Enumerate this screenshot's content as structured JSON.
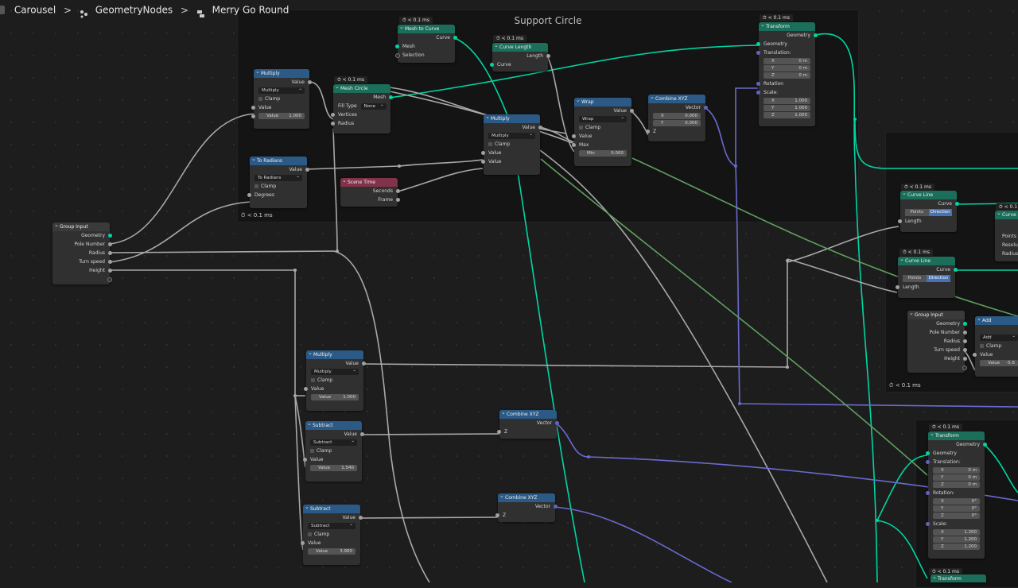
{
  "breadcrumb": {
    "items": [
      "Carousel",
      "GeometryNodes",
      "Merry Go Round"
    ],
    "separator": ">"
  },
  "frames": {
    "support_circle": {
      "label": "Support Circle",
      "timing": "< 0.1 ms"
    },
    "right_frame": {
      "timing": "< 0.1 ms"
    }
  },
  "timings": {
    "lt01": "< 0.1 ms"
  },
  "nodes": {
    "multiply1": {
      "title": "Multiply",
      "out": "Value",
      "op": "Multiply",
      "clamp": "Clamp",
      "in": "Value",
      "field_label": "Value",
      "field_value": "1.000"
    },
    "to_radians": {
      "title": "To Radians",
      "out": "Value",
      "op": "To Radians",
      "clamp": "Clamp",
      "in": "Degrees"
    },
    "mesh_circle": {
      "title": "Mesh Circle",
      "out": "Mesh",
      "fill_label": "Fill Type",
      "fill_value": "None",
      "in1": "Vertices",
      "in2": "Radius"
    },
    "mesh_to_curve": {
      "title": "Mesh to Curve",
      "out": "Curve",
      "in1": "Mesh",
      "in2": "Selection"
    },
    "curve_length": {
      "title": "Curve Length",
      "out": "Length",
      "in": "Curve"
    },
    "scene_time": {
      "title": "Scene Time",
      "out1": "Seconds",
      "out2": "Frame"
    },
    "multiply2": {
      "title": "Multiply",
      "out": "Value",
      "op": "Multiply",
      "clamp": "Clamp",
      "in1": "Value",
      "in2": "Value"
    },
    "wrap": {
      "title": "Wrap",
      "out": "Value",
      "op": "Wrap",
      "clamp": "Clamp",
      "in1": "Value",
      "in2": "Max",
      "field_label": "Min",
      "field_value": "0.000"
    },
    "combine1": {
      "title": "Combine XYZ",
      "out": "Vector",
      "x_label": "X",
      "x_value": "0.000",
      "y_label": "Y",
      "y_value": "0.000",
      "z": "Z"
    },
    "transform1": {
      "title": "Transform",
      "out": "Geometry",
      "in": "Geometry",
      "translation": "Translation:",
      "tx": "0 m",
      "ty": "0 m",
      "tz": "0 m",
      "rotation": "Rotation",
      "scale": "Scale:",
      "sx": "1.000",
      "sy": "1.000",
      "sz": "1.000"
    },
    "group_input1": {
      "title": "Group Input",
      "o1": "Geometry",
      "o2": "Pole Number",
      "o3": "Radius",
      "o4": "Turn speed",
      "o5": "Height"
    },
    "multiply3": {
      "title": "Multiply",
      "out": "Value",
      "op": "Multiply",
      "clamp": "Clamp",
      "in": "Value",
      "field_label": "Value",
      "field_value": "1.000"
    },
    "subtract1": {
      "title": "Subtract",
      "out": "Value",
      "op": "Subtract",
      "clamp": "Clamp",
      "in": "Value",
      "field_label": "Value",
      "field_value": "1.540"
    },
    "subtract2": {
      "title": "Subtract",
      "out": "Value",
      "op": "Subtract",
      "clamp": "Clamp",
      "in": "Value",
      "field_label": "Value",
      "field_value": "3.960"
    },
    "combine2": {
      "title": "Combine XYZ",
      "out": "Vector",
      "z": "Z"
    },
    "combine3": {
      "title": "Combine XYZ",
      "out": "Vector",
      "z": "Z"
    },
    "curve_line1": {
      "title": "Curve Line",
      "out": "Curve",
      "seg1": "Points",
      "seg2": "Direction",
      "in": "Length"
    },
    "curve_line2": {
      "title": "Curve Line",
      "out": "Curve",
      "seg1": "Points",
      "seg2": "Direction",
      "in": "Length"
    },
    "group_input2": {
      "title": "Group Input",
      "o1": "Geometry",
      "o2": "Pole Number",
      "o3": "Radius",
      "o4": "Turn speed",
      "o5": "Height"
    },
    "add": {
      "title": "Add",
      "op": "Add",
      "clamp": "Clamp",
      "in": "Value",
      "field_label": "Value",
      "field_value": "-5.6"
    },
    "curve_partial": {
      "title": "Curve C",
      "r1": "Points",
      "r2": "Resolut",
      "r3": "Radius"
    },
    "transform2": {
      "title": "Transform",
      "out": "Geometry",
      "in": "Geometry",
      "translation": "Translation:",
      "tx": "0 m",
      "ty": "0 m",
      "tz": "0 m",
      "rotation": "Rotation:",
      "rx": "0°",
      "ry": "0°",
      "rz": "0°",
      "scale": "Scale:",
      "sx": "1.200",
      "sy": "1.200",
      "sz": "1.200"
    },
    "transform3": {
      "title": "Transform"
    }
  },
  "axis": {
    "x": "X",
    "y": "Y",
    "z": "Z"
  },
  "colors": {
    "geometry": "#00d6a3",
    "float": "#a1a1a1",
    "vector": "#6363c7",
    "shader_green": "#5f9e5f"
  }
}
